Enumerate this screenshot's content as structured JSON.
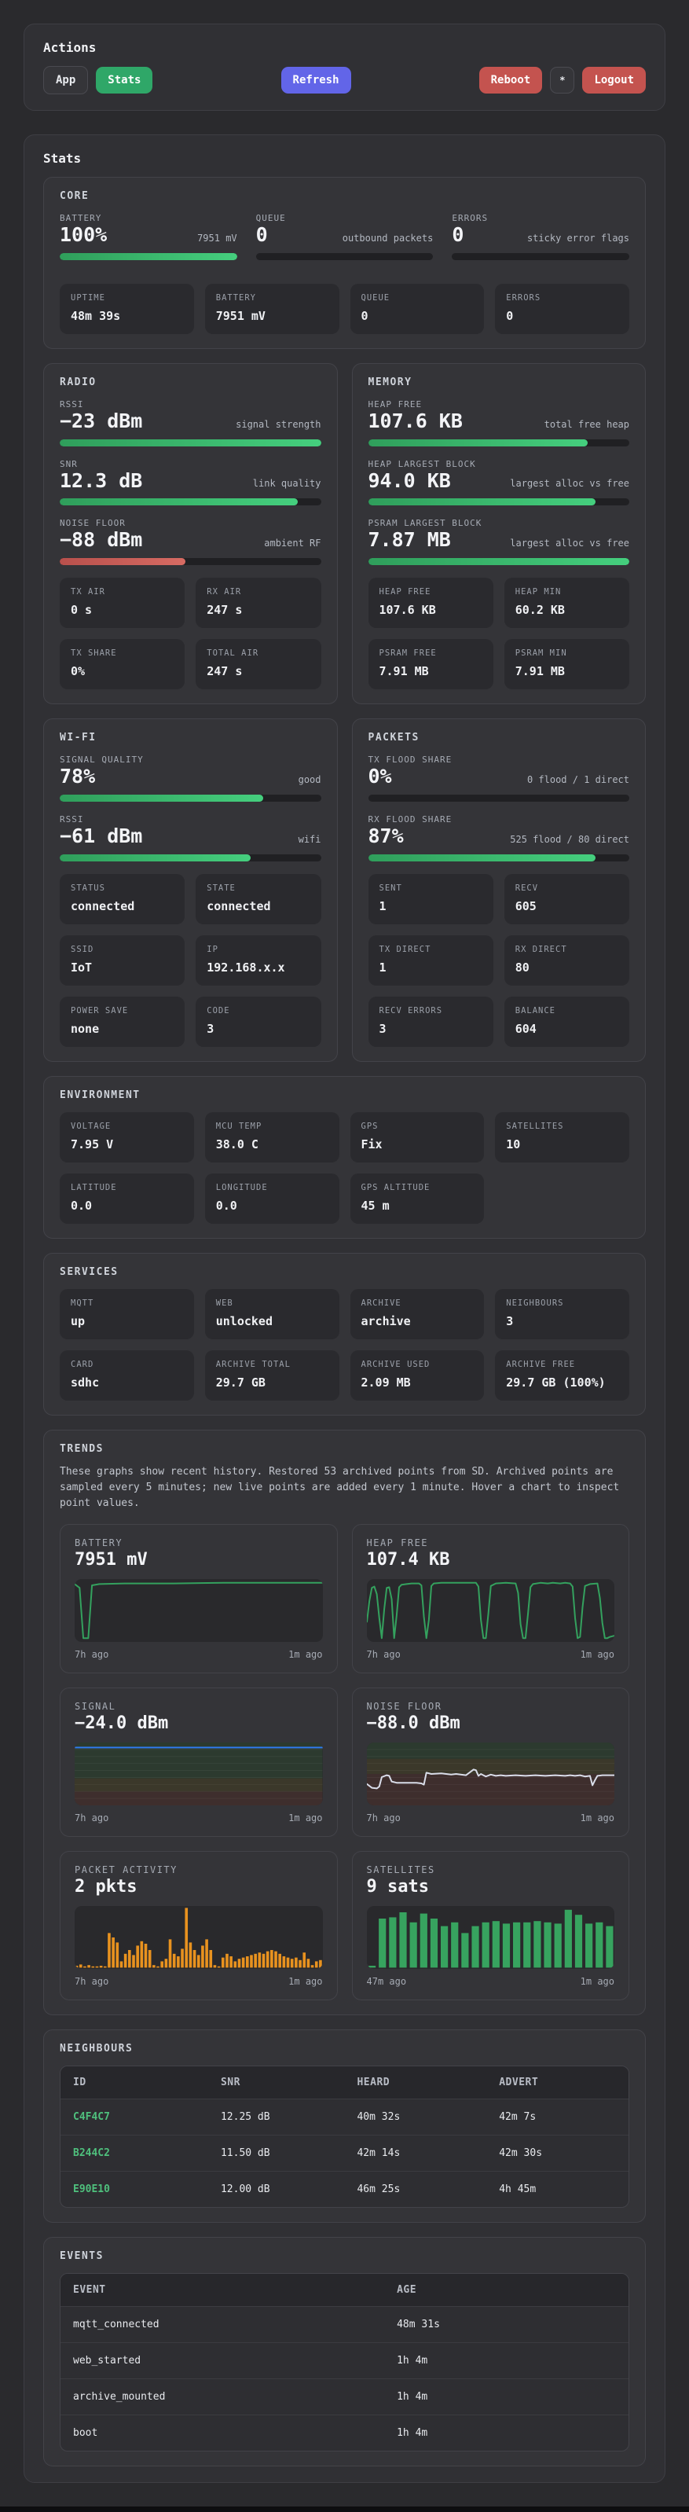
{
  "colors": {
    "accent_green": "#2fa768",
    "accent_indigo": "#6265e8",
    "accent_red": "#c4534f",
    "bar_green": "#36b269",
    "bar_red": "#c9534f",
    "chart_green": "#34a15e",
    "chart_orange": "#e8921f",
    "chart_blue": "#2f7bef",
    "chart_noise_line": "#d9dde9",
    "neighbour_id_green": "#4fc07d"
  },
  "actions": {
    "title": "Actions",
    "app": "App",
    "stats": "Stats",
    "refresh": "Refresh",
    "reboot": "Reboot",
    "star": "*",
    "logout": "Logout"
  },
  "stats_title": "Stats",
  "core": {
    "title": "CORE",
    "heroes": [
      {
        "label": "BATTERY",
        "value": "100%",
        "sub": "7951 mV",
        "pct": 100,
        "tone": "green"
      },
      {
        "label": "QUEUE",
        "value": "0",
        "sub": "outbound packets",
        "pct": 0,
        "tone": "green"
      },
      {
        "label": "ERRORS",
        "value": "0",
        "sub": "sticky error flags",
        "pct": 0,
        "tone": "green"
      }
    ],
    "tiles": [
      {
        "label": "UPTIME",
        "value": "48m 39s"
      },
      {
        "label": "BATTERY",
        "value": "7951 mV"
      },
      {
        "label": "QUEUE",
        "value": "0"
      },
      {
        "label": "ERRORS",
        "value": "0"
      }
    ]
  },
  "radio": {
    "title": "RADIO",
    "heroes": [
      {
        "label": "RSSI",
        "value": "−23 dBm",
        "sub": "signal strength",
        "pct": 100,
        "tone": "green"
      },
      {
        "label": "SNR",
        "value": "12.3 dB",
        "sub": "link quality",
        "pct": 91,
        "tone": "green"
      },
      {
        "label": "NOISE FLOOR",
        "value": "−88 dBm",
        "sub": "ambient RF",
        "pct": 48,
        "tone": "red"
      }
    ],
    "tiles": [
      {
        "label": "TX AIR",
        "value": "0 s"
      },
      {
        "label": "RX AIR",
        "value": "247 s"
      },
      {
        "label": "TX SHARE",
        "value": "0%"
      },
      {
        "label": "TOTAL AIR",
        "value": "247 s"
      }
    ]
  },
  "memory": {
    "title": "MEMORY",
    "heroes": [
      {
        "label": "HEAP FREE",
        "value": "107.6 KB",
        "sub": "total free heap",
        "pct": 84,
        "tone": "green"
      },
      {
        "label": "HEAP LARGEST BLOCK",
        "value": "94.0 KB",
        "sub": "largest alloc vs free",
        "pct": 87,
        "tone": "green"
      },
      {
        "label": "PSRAM LARGEST BLOCK",
        "value": "7.87 MB",
        "sub": "largest alloc vs free",
        "pct": 100,
        "tone": "green"
      }
    ],
    "tiles": [
      {
        "label": "HEAP FREE",
        "value": "107.6 KB"
      },
      {
        "label": "HEAP MIN",
        "value": "60.2 KB"
      },
      {
        "label": "PSRAM FREE",
        "value": "7.91 MB"
      },
      {
        "label": "PSRAM MIN",
        "value": "7.91 MB"
      }
    ]
  },
  "wifi": {
    "title": "WI-FI",
    "heroes": [
      {
        "label": "SIGNAL QUALITY",
        "value": "78%",
        "sub": "good",
        "pct": 78,
        "tone": "green"
      },
      {
        "label": "RSSI",
        "value": "−61 dBm",
        "sub": "wifi",
        "pct": 73,
        "tone": "green"
      }
    ],
    "tiles": [
      {
        "label": "STATUS",
        "value": "connected"
      },
      {
        "label": "STATE",
        "value": "connected"
      },
      {
        "label": "SSID",
        "value": "IoT"
      },
      {
        "label": "IP",
        "value": "192.168.x.x"
      },
      {
        "label": "POWER SAVE",
        "value": "none"
      },
      {
        "label": "CODE",
        "value": "3"
      }
    ]
  },
  "packets": {
    "title": "PACKETS",
    "heroes": [
      {
        "label": "TX FLOOD SHARE",
        "value": "0%",
        "sub": "0 flood / 1 direct",
        "pct": 0,
        "tone": "green"
      },
      {
        "label": "RX FLOOD SHARE",
        "value": "87%",
        "sub": "525 flood / 80 direct",
        "pct": 87,
        "tone": "green"
      }
    ],
    "tiles": [
      {
        "label": "SENT",
        "value": "1"
      },
      {
        "label": "RECV",
        "value": "605"
      },
      {
        "label": "TX DIRECT",
        "value": "1"
      },
      {
        "label": "RX DIRECT",
        "value": "80"
      },
      {
        "label": "RECV ERRORS",
        "value": "3"
      },
      {
        "label": "BALANCE",
        "value": "604"
      }
    ]
  },
  "environment": {
    "title": "ENVIRONMENT",
    "tiles": [
      {
        "label": "VOLTAGE",
        "value": "7.95 V"
      },
      {
        "label": "MCU TEMP",
        "value": "38.0 C"
      },
      {
        "label": "GPS",
        "value": "Fix"
      },
      {
        "label": "SATELLITES",
        "value": "10"
      },
      {
        "label": "LATITUDE",
        "value": "0.0"
      },
      {
        "label": "LONGITUDE",
        "value": "0.0"
      },
      {
        "label": "GPS ALTITUDE",
        "value": "45 m"
      }
    ]
  },
  "services": {
    "title": "SERVICES",
    "tiles": [
      {
        "label": "MQTT",
        "value": "up"
      },
      {
        "label": "WEB",
        "value": "unlocked"
      },
      {
        "label": "ARCHIVE",
        "value": "archive"
      },
      {
        "label": "NEIGHBOURS",
        "value": "3"
      },
      {
        "label": "CARD",
        "value": "sdhc"
      },
      {
        "label": "ARCHIVE TOTAL",
        "value": "29.7 GB"
      },
      {
        "label": "ARCHIVE USED",
        "value": "2.09 MB"
      },
      {
        "label": "ARCHIVE FREE",
        "value": "29.7 GB (100%)"
      }
    ]
  },
  "trends": {
    "title": "TRENDS",
    "description": "These graphs show recent history. Restored 53 archived points from SD. Archived points are sampled every 5 minutes; new live points are added every 1 minute. Hover a chart to inspect point values."
  },
  "chart_data": [
    {
      "type": "line",
      "label": "BATTERY",
      "value": "7951 mV",
      "x_left": "7h ago",
      "x_right": "1m ago",
      "color": "#34a15e",
      "points_pct": [
        [
          0,
          8
        ],
        [
          2,
          14
        ],
        [
          3.5,
          94
        ],
        [
          5.5,
          94
        ],
        [
          7,
          10
        ],
        [
          10,
          8
        ],
        [
          20,
          7
        ],
        [
          40,
          7
        ],
        [
          60,
          6
        ],
        [
          80,
          6
        ],
        [
          100,
          6
        ]
      ]
    },
    {
      "type": "line",
      "label": "HEAP FREE",
      "value": "107.4 KB",
      "x_left": "7h ago",
      "x_right": "1m ago",
      "color": "#34a15e",
      "points_pct": [
        [
          0,
          68
        ],
        [
          1,
          35
        ],
        [
          2,
          14
        ],
        [
          3,
          12
        ],
        [
          4,
          24
        ],
        [
          5,
          62
        ],
        [
          6,
          94
        ],
        [
          7,
          48
        ],
        [
          8,
          14
        ],
        [
          9,
          13
        ],
        [
          10,
          32
        ],
        [
          11,
          94
        ],
        [
          12,
          58
        ],
        [
          13,
          13
        ],
        [
          14,
          9
        ],
        [
          16,
          8
        ],
        [
          18,
          7
        ],
        [
          21,
          7
        ],
        [
          22,
          10
        ],
        [
          23,
          60
        ],
        [
          24,
          94
        ],
        [
          25,
          65
        ],
        [
          26,
          11
        ],
        [
          27,
          7
        ],
        [
          30,
          6
        ],
        [
          35,
          6
        ],
        [
          40,
          6
        ],
        [
          44,
          6
        ],
        [
          45,
          12
        ],
        [
          46,
          65
        ],
        [
          47,
          94
        ],
        [
          48,
          94
        ],
        [
          49,
          55
        ],
        [
          50,
          11
        ],
        [
          52,
          7
        ],
        [
          56,
          6
        ],
        [
          60,
          7
        ],
        [
          61,
          22
        ],
        [
          62,
          72
        ],
        [
          63,
          94
        ],
        [
          64,
          94
        ],
        [
          65,
          55
        ],
        [
          66,
          13
        ],
        [
          67,
          8
        ],
        [
          70,
          6
        ],
        [
          73,
          7
        ],
        [
          75,
          6
        ],
        [
          78,
          7
        ],
        [
          80,
          6
        ],
        [
          82,
          7
        ],
        [
          83,
          12
        ],
        [
          84,
          62
        ],
        [
          85,
          94
        ],
        [
          86,
          92
        ],
        [
          87,
          45
        ],
        [
          88,
          11
        ],
        [
          90,
          8
        ],
        [
          93,
          7
        ],
        [
          94,
          30
        ],
        [
          95,
          70
        ],
        [
          96,
          94
        ],
        [
          97,
          94
        ],
        [
          98,
          92
        ],
        [
          100,
          90
        ]
      ]
    },
    {
      "type": "line",
      "label": "SIGNAL",
      "value": "−24.0 dBm",
      "x_left": "7h ago",
      "x_right": "1m ago",
      "color": "#2f7bef",
      "gridlines": 9,
      "zones": [
        {
          "from": 0,
          "to": 57,
          "color": "#2c3a2f"
        },
        {
          "from": 57,
          "to": 78,
          "color": "#3b382a"
        },
        {
          "from": 78,
          "to": 100,
          "color": "#3e2e2d"
        }
      ],
      "points_pct": [
        [
          0,
          8
        ],
        [
          100,
          8
        ]
      ]
    },
    {
      "type": "line",
      "label": "NOISE FLOOR",
      "value": "−88.0 dBm",
      "x_left": "7h ago",
      "x_right": "1m ago",
      "color": "#d9dde9",
      "gridlines": 9,
      "zones": [
        {
          "from": 0,
          "to": 26,
          "color": "#2c3a2f"
        },
        {
          "from": 26,
          "to": 50,
          "color": "#3b382a"
        },
        {
          "from": 50,
          "to": 100,
          "color": "#3e2e2d"
        }
      ],
      "points_pct": [
        [
          0,
          66
        ],
        [
          2,
          72
        ],
        [
          4,
          73
        ],
        [
          5,
          70
        ],
        [
          6,
          55
        ],
        [
          8,
          52
        ],
        [
          9,
          53
        ],
        [
          10,
          62
        ],
        [
          12,
          64
        ],
        [
          20,
          64
        ],
        [
          22,
          65
        ],
        [
          23,
          67
        ],
        [
          24,
          48
        ],
        [
          26,
          50
        ],
        [
          30,
          49
        ],
        [
          34,
          51
        ],
        [
          36,
          50
        ],
        [
          40,
          52
        ],
        [
          42,
          46
        ],
        [
          43,
          43
        ],
        [
          44,
          44
        ],
        [
          45,
          53
        ],
        [
          46,
          50
        ],
        [
          47,
          52
        ],
        [
          48,
          54
        ],
        [
          50,
          51
        ],
        [
          52,
          53
        ],
        [
          54,
          52
        ],
        [
          56,
          53
        ],
        [
          60,
          52
        ],
        [
          64,
          53
        ],
        [
          68,
          52
        ],
        [
          72,
          53
        ],
        [
          76,
          52
        ],
        [
          80,
          53
        ],
        [
          82,
          52
        ],
        [
          84,
          53
        ],
        [
          86,
          52
        ],
        [
          88,
          54
        ],
        [
          90,
          53
        ],
        [
          91,
          68
        ],
        [
          92,
          60
        ],
        [
          93,
          53
        ],
        [
          95,
          52
        ],
        [
          100,
          52
        ]
      ]
    },
    {
      "type": "bar",
      "label": "PACKET ACTIVITY",
      "value": "2 pkts",
      "x_left": "7h ago",
      "x_right": "1m ago",
      "color": "#e8921f",
      "bars_pct": [
        3,
        5,
        2,
        4,
        2,
        2,
        3,
        2,
        55,
        48,
        40,
        10,
        22,
        28,
        20,
        35,
        42,
        38,
        28,
        4,
        2,
        10,
        14,
        45,
        22,
        18,
        30,
        95,
        40,
        28,
        20,
        35,
        45,
        28,
        4,
        2,
        16,
        22,
        18,
        10,
        14,
        16,
        18,
        20,
        22,
        24,
        22,
        26,
        28,
        26,
        22,
        18,
        16,
        14,
        16,
        12,
        24,
        14,
        4,
        10,
        12
      ]
    },
    {
      "type": "bar",
      "label": "SATELLITES",
      "value": "9 sats",
      "x_left": "47m ago",
      "x_right": "1m ago",
      "color": "#37a35f",
      "bars_pct": [
        3,
        78,
        80,
        88,
        72,
        86,
        78,
        66,
        72,
        55,
        66,
        72,
        74,
        70,
        72,
        72,
        74,
        72,
        70,
        92,
        84,
        70,
        72,
        66
      ]
    }
  ],
  "neighbours": {
    "title": "NEIGHBOURS",
    "headers": [
      "ID",
      "SNR",
      "HEARD",
      "ADVERT"
    ],
    "rows": [
      [
        "C4F4C7",
        "12.25 dB",
        "40m 32s",
        "42m 7s"
      ],
      [
        "B244C2",
        "11.50 dB",
        "42m 14s",
        "42m 30s"
      ],
      [
        "E90E10",
        "12.00 dB",
        "46m 25s",
        "4h 45m"
      ]
    ]
  },
  "events": {
    "title": "EVENTS",
    "headers": [
      "EVENT",
      "AGE"
    ],
    "rows": [
      [
        "mqtt_connected",
        "48m 31s"
      ],
      [
        "web_started",
        "1h 4m"
      ],
      [
        "archive_mounted",
        "1h 4m"
      ],
      [
        "boot",
        "1h 4m"
      ]
    ]
  }
}
